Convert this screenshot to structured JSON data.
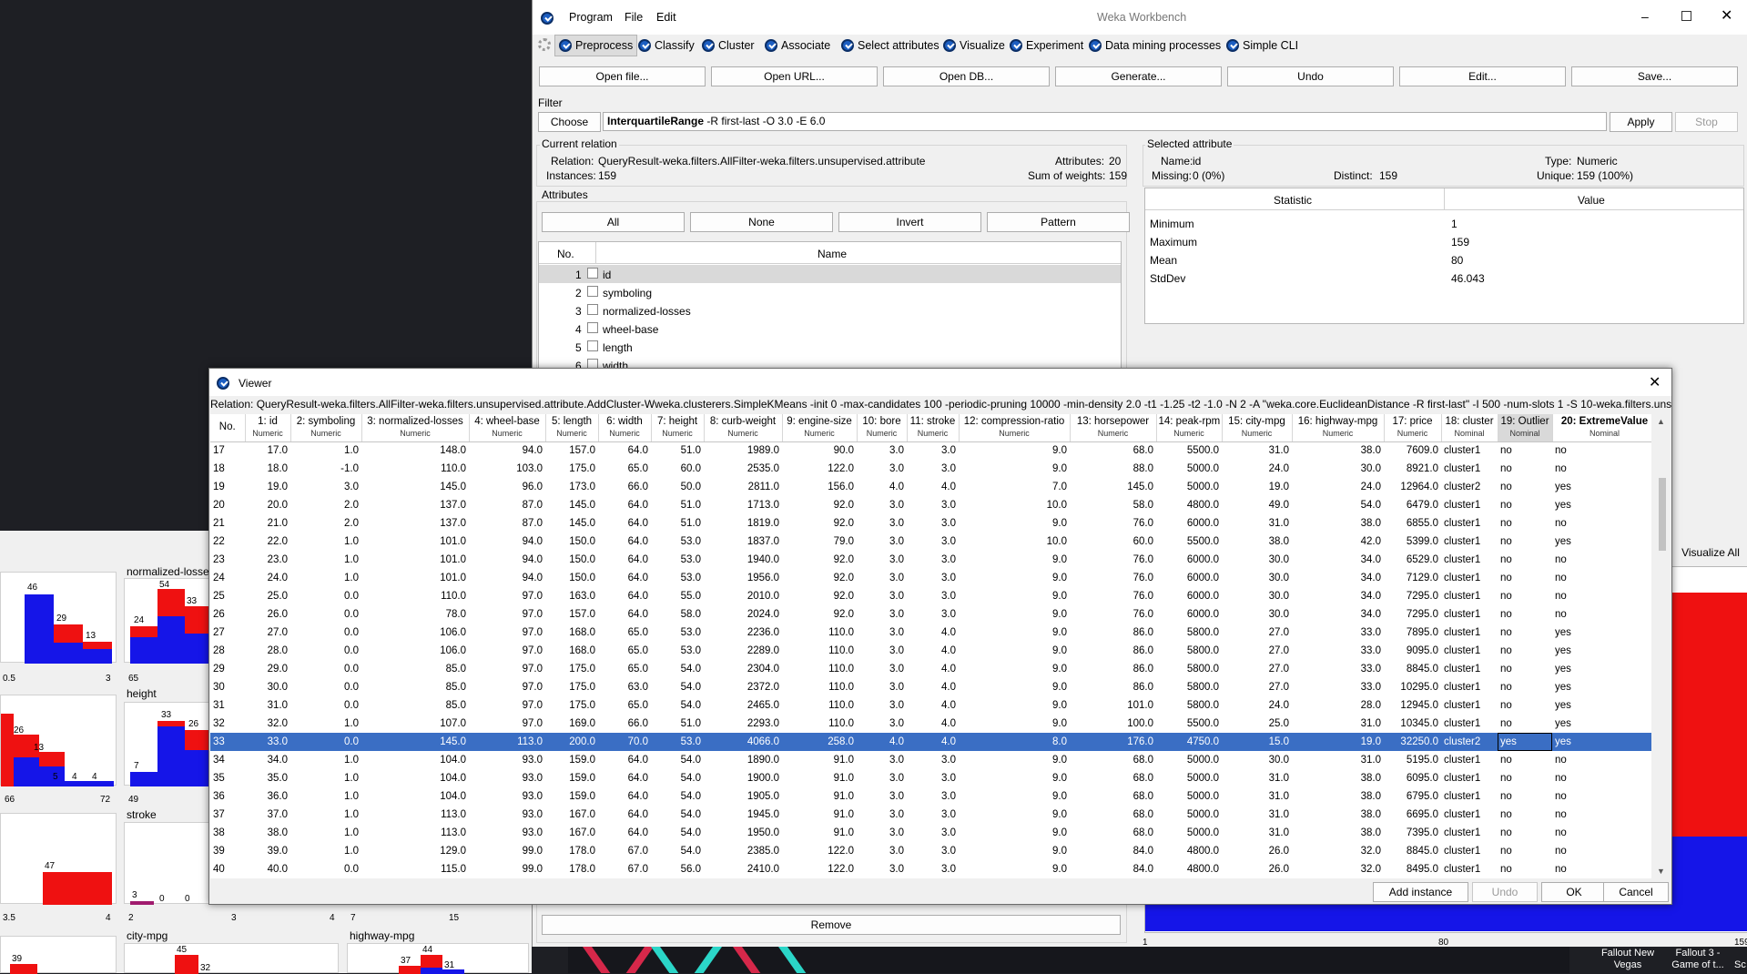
{
  "window": {
    "title": "Weka Workbench",
    "menu": [
      "Program",
      "File",
      "Edit"
    ]
  },
  "tabs": [
    "Preprocess",
    "Classify",
    "Cluster",
    "Associate",
    "Select attributes",
    "Visualize",
    "Experiment",
    "Data mining processes",
    "Simple CLI"
  ],
  "toolbar": [
    "Open file...",
    "Open URL...",
    "Open DB...",
    "Generate...",
    "Undo",
    "Edit...",
    "Save..."
  ],
  "filter": {
    "label": "Filter",
    "choose": "Choose",
    "name": "InterquartileRange",
    "options": " -R first-last -O 3.0 -E 6.0",
    "apply": "Apply",
    "stop": "Stop"
  },
  "relation": {
    "legend": "Current relation",
    "relation_label": "Relation:",
    "relation": "QueryResult-weka.filters.AllFilter-weka.filters.unsupervised.attribute.AddCluster-W...",
    "instances_label": "Instances:",
    "instances": "159",
    "attributes_label": "Attributes:",
    "attributes": "20",
    "weights_label": "Sum of weights:",
    "weights": "159"
  },
  "attributes": {
    "legend": "Attributes",
    "buttons": [
      "All",
      "None",
      "Invert",
      "Pattern"
    ],
    "col_no": "No.",
    "col_name": "Name",
    "rows": [
      {
        "no": "1",
        "name": "id"
      },
      {
        "no": "2",
        "name": "symboling"
      },
      {
        "no": "3",
        "name": "normalized-losses"
      },
      {
        "no": "4",
        "name": "wheel-base"
      },
      {
        "no": "5",
        "name": "length"
      },
      {
        "no": "6",
        "name": "width"
      }
    ],
    "remove": "Remove"
  },
  "selected": {
    "legend": "Selected attribute",
    "name_label": "Name:",
    "name": "id",
    "type_label": "Type:",
    "type": "Numeric",
    "missing_label": "Missing:",
    "missing": "0 (0%)",
    "distinct_label": "Distinct:",
    "distinct": "159",
    "unique_label": "Unique:",
    "unique": "159 (100%)",
    "col_stat": "Statistic",
    "col_value": "Value",
    "stats": [
      [
        "Minimum",
        "1"
      ],
      [
        "Maximum",
        "159"
      ],
      [
        "Mean",
        "80"
      ],
      [
        "StdDev",
        "46.043"
      ]
    ],
    "visualize_all": "Visualize All",
    "axis": [
      "1",
      "80",
      "159"
    ]
  },
  "hist_labels": {
    "nl": "normalized-losses",
    "height": "height",
    "stroke": "stroke",
    "city": "city-mpg",
    "highway": "highway-mpg"
  },
  "hist_counts": {
    "a": [
      "46",
      "29",
      "13"
    ],
    "b": [
      "54",
      "24",
      "33"
    ],
    "c": [
      "26",
      "13",
      "5",
      "4",
      "4"
    ],
    "d": [
      "33",
      "26",
      "7"
    ],
    "e": [
      "47"
    ],
    "f": [
      "3",
      "0",
      "0"
    ],
    "g": [
      "39"
    ],
    "h": [
      "45",
      "32"
    ],
    "i": [
      "37",
      "44",
      "31"
    ]
  },
  "hist_ticks": {
    "a": [
      "0.5",
      "3"
    ],
    "b": [
      "65"
    ],
    "c": [
      "66",
      "72"
    ],
    "d": [
      "49"
    ],
    "e": [
      "3.5",
      "4"
    ],
    "f": [
      "2",
      "3",
      "4"
    ],
    "g": [
      "7",
      "15"
    ]
  },
  "taskbar": [
    [
      "Fallout New",
      "Vegas"
    ],
    [
      "Fallout 3 -",
      "Game of t..."
    ],
    [
      "Sc"
    ]
  ],
  "viewer": {
    "title": "Viewer",
    "relation": "Relation: QueryResult-weka.filters.AllFilter-weka.filters.unsupervised.attribute.AddCluster-Wweka.clusterers.SimpleKMeans -init 0 -max-candidates 100 -periodic-pruning 10000 -min-density 2.0 -t1 -1.25 -t2 -1.0 -N 2 -A \"weka.core.EuclideanDistance -R first-last\" -I 500 -num-slots 1 -S 10-weka.filters.unsu...",
    "columns": [
      {
        "h": "No.",
        "t": ""
      },
      {
        "h": "1: id",
        "t": "Numeric"
      },
      {
        "h": "2: symboling",
        "t": "Numeric"
      },
      {
        "h": "3: normalized-losses",
        "t": "Numeric"
      },
      {
        "h": "4: wheel-base",
        "t": "Numeric"
      },
      {
        "h": "5: length",
        "t": "Numeric"
      },
      {
        "h": "6: width",
        "t": "Numeric"
      },
      {
        "h": "7: height",
        "t": "Numeric"
      },
      {
        "h": "8: curb-weight",
        "t": "Numeric"
      },
      {
        "h": "9: engine-size",
        "t": "Numeric"
      },
      {
        "h": "10: bore",
        "t": "Numeric"
      },
      {
        "h": "11: stroke",
        "t": "Numeric"
      },
      {
        "h": "12: compression-ratio",
        "t": "Numeric"
      },
      {
        "h": "13: horsepower",
        "t": "Numeric"
      },
      {
        "h": "14: peak-rpm",
        "t": "Numeric"
      },
      {
        "h": "15: city-mpg",
        "t": "Numeric"
      },
      {
        "h": "16: highway-mpg",
        "t": "Numeric"
      },
      {
        "h": "17: price",
        "t": "Numeric"
      },
      {
        "h": "18: cluster",
        "t": "Nominal"
      },
      {
        "h": "19: Outlier",
        "t": "Nominal"
      },
      {
        "h": "20: ExtremeValue",
        "t": "Nominal"
      }
    ],
    "rows": [
      [
        "17",
        "17.0",
        "1.0",
        "148.0",
        "94.0",
        "157.0",
        "64.0",
        "51.0",
        "1989.0",
        "90.0",
        "3.0",
        "3.0",
        "9.0",
        "68.0",
        "5500.0",
        "31.0",
        "38.0",
        "7609.0",
        "cluster1",
        "no",
        "no"
      ],
      [
        "18",
        "18.0",
        "-1.0",
        "110.0",
        "103.0",
        "175.0",
        "65.0",
        "60.0",
        "2535.0",
        "122.0",
        "3.0",
        "3.0",
        "9.0",
        "88.0",
        "5000.0",
        "24.0",
        "30.0",
        "8921.0",
        "cluster1",
        "no",
        "no"
      ],
      [
        "19",
        "19.0",
        "3.0",
        "145.0",
        "96.0",
        "173.0",
        "66.0",
        "50.0",
        "2811.0",
        "156.0",
        "4.0",
        "4.0",
        "7.0",
        "145.0",
        "5000.0",
        "19.0",
        "24.0",
        "12964.0",
        "cluster2",
        "no",
        "yes"
      ],
      [
        "20",
        "20.0",
        "2.0",
        "137.0",
        "87.0",
        "145.0",
        "64.0",
        "51.0",
        "1713.0",
        "92.0",
        "3.0",
        "3.0",
        "10.0",
        "58.0",
        "4800.0",
        "49.0",
        "54.0",
        "6479.0",
        "cluster1",
        "no",
        "yes"
      ],
      [
        "21",
        "21.0",
        "2.0",
        "137.0",
        "87.0",
        "145.0",
        "64.0",
        "51.0",
        "1819.0",
        "92.0",
        "3.0",
        "3.0",
        "9.0",
        "76.0",
        "6000.0",
        "31.0",
        "38.0",
        "6855.0",
        "cluster1",
        "no",
        "no"
      ],
      [
        "22",
        "22.0",
        "1.0",
        "101.0",
        "94.0",
        "150.0",
        "64.0",
        "53.0",
        "1837.0",
        "79.0",
        "3.0",
        "3.0",
        "10.0",
        "60.0",
        "5500.0",
        "38.0",
        "42.0",
        "5399.0",
        "cluster1",
        "no",
        "yes"
      ],
      [
        "23",
        "23.0",
        "1.0",
        "101.0",
        "94.0",
        "150.0",
        "64.0",
        "53.0",
        "1940.0",
        "92.0",
        "3.0",
        "3.0",
        "9.0",
        "76.0",
        "6000.0",
        "30.0",
        "34.0",
        "6529.0",
        "cluster1",
        "no",
        "no"
      ],
      [
        "24",
        "24.0",
        "1.0",
        "101.0",
        "94.0",
        "150.0",
        "64.0",
        "53.0",
        "1956.0",
        "92.0",
        "3.0",
        "3.0",
        "9.0",
        "76.0",
        "6000.0",
        "30.0",
        "34.0",
        "7129.0",
        "cluster1",
        "no",
        "no"
      ],
      [
        "25",
        "25.0",
        "0.0",
        "110.0",
        "97.0",
        "163.0",
        "64.0",
        "55.0",
        "2010.0",
        "92.0",
        "3.0",
        "3.0",
        "9.0",
        "76.0",
        "6000.0",
        "30.0",
        "34.0",
        "7295.0",
        "cluster1",
        "no",
        "no"
      ],
      [
        "26",
        "26.0",
        "0.0",
        "78.0",
        "97.0",
        "157.0",
        "64.0",
        "58.0",
        "2024.0",
        "92.0",
        "3.0",
        "3.0",
        "9.0",
        "76.0",
        "6000.0",
        "30.0",
        "34.0",
        "7295.0",
        "cluster1",
        "no",
        "no"
      ],
      [
        "27",
        "27.0",
        "0.0",
        "106.0",
        "97.0",
        "168.0",
        "65.0",
        "53.0",
        "2236.0",
        "110.0",
        "3.0",
        "4.0",
        "9.0",
        "86.0",
        "5800.0",
        "27.0",
        "33.0",
        "7895.0",
        "cluster1",
        "no",
        "yes"
      ],
      [
        "28",
        "28.0",
        "0.0",
        "106.0",
        "97.0",
        "168.0",
        "65.0",
        "53.0",
        "2289.0",
        "110.0",
        "3.0",
        "4.0",
        "9.0",
        "86.0",
        "5800.0",
        "27.0",
        "33.0",
        "9095.0",
        "cluster1",
        "no",
        "yes"
      ],
      [
        "29",
        "29.0",
        "0.0",
        "85.0",
        "97.0",
        "175.0",
        "65.0",
        "54.0",
        "2304.0",
        "110.0",
        "3.0",
        "4.0",
        "9.0",
        "86.0",
        "5800.0",
        "27.0",
        "33.0",
        "8845.0",
        "cluster1",
        "no",
        "yes"
      ],
      [
        "30",
        "30.0",
        "0.0",
        "85.0",
        "97.0",
        "175.0",
        "63.0",
        "54.0",
        "2372.0",
        "110.0",
        "3.0",
        "4.0",
        "9.0",
        "86.0",
        "5800.0",
        "27.0",
        "33.0",
        "10295.0",
        "cluster1",
        "no",
        "yes"
      ],
      [
        "31",
        "31.0",
        "0.0",
        "85.0",
        "97.0",
        "175.0",
        "65.0",
        "54.0",
        "2465.0",
        "110.0",
        "3.0",
        "4.0",
        "9.0",
        "101.0",
        "5800.0",
        "24.0",
        "28.0",
        "12945.0",
        "cluster1",
        "no",
        "yes"
      ],
      [
        "32",
        "32.0",
        "1.0",
        "107.0",
        "97.0",
        "169.0",
        "66.0",
        "51.0",
        "2293.0",
        "110.0",
        "3.0",
        "4.0",
        "9.0",
        "100.0",
        "5500.0",
        "25.0",
        "31.0",
        "10345.0",
        "cluster1",
        "no",
        "yes"
      ],
      [
        "33",
        "33.0",
        "0.0",
        "145.0",
        "113.0",
        "200.0",
        "70.0",
        "53.0",
        "4066.0",
        "258.0",
        "4.0",
        "4.0",
        "8.0",
        "176.0",
        "4750.0",
        "15.0",
        "19.0",
        "32250.0",
        "cluster2",
        "yes",
        "yes"
      ],
      [
        "34",
        "34.0",
        "1.0",
        "104.0",
        "93.0",
        "159.0",
        "64.0",
        "54.0",
        "1890.0",
        "91.0",
        "3.0",
        "3.0",
        "9.0",
        "68.0",
        "5000.0",
        "30.0",
        "31.0",
        "5195.0",
        "cluster1",
        "no",
        "no"
      ],
      [
        "35",
        "35.0",
        "1.0",
        "104.0",
        "93.0",
        "159.0",
        "64.0",
        "54.0",
        "1900.0",
        "91.0",
        "3.0",
        "3.0",
        "9.0",
        "68.0",
        "5000.0",
        "31.0",
        "38.0",
        "6095.0",
        "cluster1",
        "no",
        "no"
      ],
      [
        "36",
        "36.0",
        "1.0",
        "104.0",
        "93.0",
        "159.0",
        "64.0",
        "54.0",
        "1905.0",
        "91.0",
        "3.0",
        "3.0",
        "9.0",
        "68.0",
        "5000.0",
        "31.0",
        "38.0",
        "6795.0",
        "cluster1",
        "no",
        "no"
      ],
      [
        "37",
        "37.0",
        "1.0",
        "113.0",
        "93.0",
        "167.0",
        "64.0",
        "54.0",
        "1945.0",
        "91.0",
        "3.0",
        "3.0",
        "9.0",
        "68.0",
        "5000.0",
        "31.0",
        "38.0",
        "6695.0",
        "cluster1",
        "no",
        "no"
      ],
      [
        "38",
        "38.0",
        "1.0",
        "113.0",
        "93.0",
        "167.0",
        "64.0",
        "54.0",
        "1950.0",
        "91.0",
        "3.0",
        "3.0",
        "9.0",
        "68.0",
        "5000.0",
        "31.0",
        "38.0",
        "7395.0",
        "cluster1",
        "no",
        "no"
      ],
      [
        "39",
        "39.0",
        "1.0",
        "129.0",
        "99.0",
        "178.0",
        "67.0",
        "54.0",
        "2385.0",
        "122.0",
        "3.0",
        "3.0",
        "9.0",
        "84.0",
        "4800.0",
        "26.0",
        "32.0",
        "8845.0",
        "cluster1",
        "no",
        "no"
      ],
      [
        "40",
        "40.0",
        "0.0",
        "115.0",
        "99.0",
        "178.0",
        "67.0",
        "56.0",
        "2410.0",
        "122.0",
        "3.0",
        "3.0",
        "9.0",
        "84.0",
        "4800.0",
        "26.0",
        "32.0",
        "8495.0",
        "cluster1",
        "no",
        "no"
      ]
    ],
    "selected_row": "33",
    "buttons": {
      "add": "Add instance",
      "undo": "Undo",
      "ok": "OK",
      "cancel": "Cancel"
    }
  }
}
